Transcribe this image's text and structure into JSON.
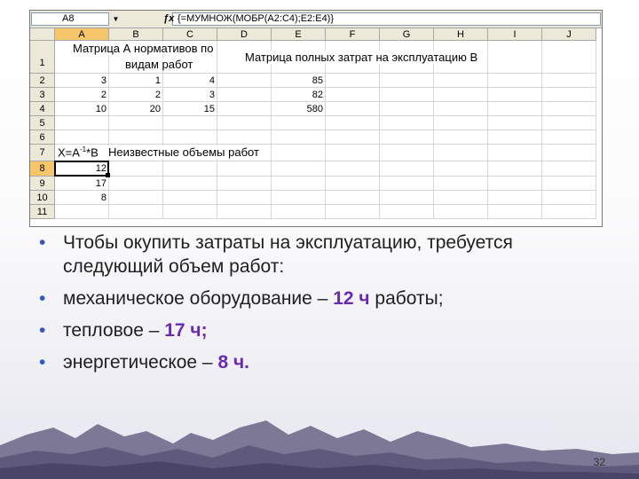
{
  "formula_bar": {
    "name_box": "A8",
    "fx_icon": "fx-icon",
    "formula": "{=МУМНОЖ(МОБР(A2:C4);E2:E4)}"
  },
  "columns": [
    "A",
    "B",
    "C",
    "D",
    "E",
    "F",
    "G",
    "H",
    "I",
    "J"
  ],
  "rows": [
    "1",
    "2",
    "3",
    "4",
    "5",
    "6",
    "7",
    "8",
    "9",
    "10",
    "11"
  ],
  "cells": {
    "A2": "3",
    "B2": "1",
    "C2": "4",
    "E2": "85",
    "A3": "2",
    "B3": "2",
    "C3": "3",
    "E3": "82",
    "A4": "10",
    "B4": "20",
    "C4": "15",
    "E4": "580",
    "A8": "12",
    "A9": "17",
    "A10": "8"
  },
  "labels": {
    "matrix_a_line1": "Матрица А нормативов по",
    "matrix_a_line2": "видам работ",
    "matrix_b": "Матрица полных затрат на эксплуатацию В",
    "x_formula": "X=A",
    "x_formula_sup": "-1",
    "x_formula_rest": "*В",
    "unknown": "Неизвестные объемы работ"
  },
  "selected_cell": "A8",
  "bullets": [
    {
      "text": "Чтобы окупить затраты на эксплуатацию, требуется следующий объем работ:"
    },
    {
      "prefix": "механическое оборудование – ",
      "highlight": "12 ч",
      "suffix": " работы;"
    },
    {
      "prefix": "тепловое – ",
      "highlight": "17 ч;",
      "suffix": ""
    },
    {
      "prefix": "энергетическое – ",
      "highlight": "8 ч.",
      "suffix": ""
    }
  ],
  "page_number": "32",
  "colors": {
    "highlight": "#6a2ab0",
    "bullet": "#3a55c0",
    "selected_header": "#f6c66a"
  }
}
